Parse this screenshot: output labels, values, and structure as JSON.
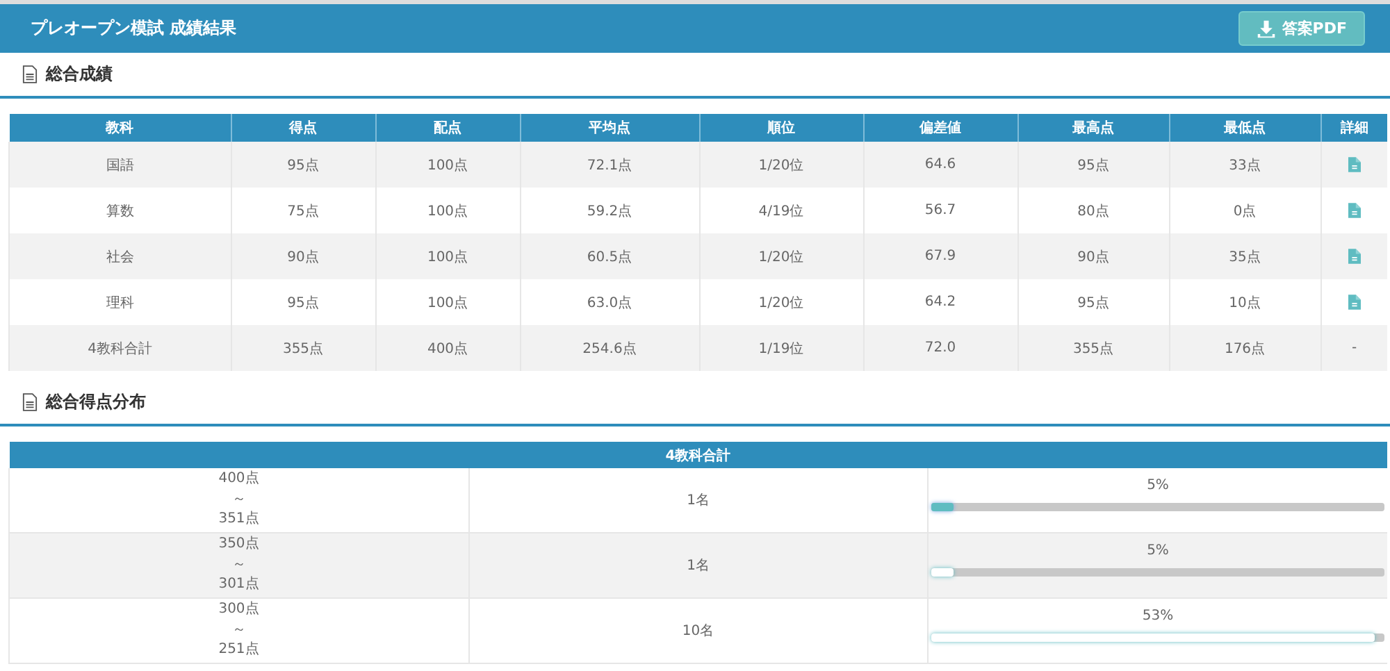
{
  "header": {
    "title": "プレオープン模試 成績結果",
    "pdf_button": "答案PDF"
  },
  "summary": {
    "heading": "総合成績",
    "columns": [
      "教科",
      "得点",
      "配点",
      "平均点",
      "順位",
      "偏差値",
      "最高点",
      "最低点",
      "詳細"
    ],
    "rows": [
      {
        "cells": [
          "国語",
          "95点",
          "100点",
          "72.1点",
          "1/20位",
          "64.6",
          "95点",
          "33点"
        ],
        "detail": {
          "kind": "icon"
        }
      },
      {
        "cells": [
          "算数",
          "75点",
          "100点",
          "59.2点",
          "4/19位",
          "56.7",
          "80点",
          "0点"
        ],
        "detail": {
          "kind": "icon"
        }
      },
      {
        "cells": [
          "社会",
          "90点",
          "100点",
          "60.5点",
          "1/20位",
          "67.9",
          "90点",
          "35点"
        ],
        "detail": {
          "kind": "icon"
        }
      },
      {
        "cells": [
          "理科",
          "95点",
          "100点",
          "63.0点",
          "1/20位",
          "64.2",
          "95点",
          "10点"
        ],
        "detail": {
          "kind": "icon"
        }
      },
      {
        "cells": [
          "4教科合計",
          "355点",
          "400点",
          "254.6点",
          "1/19位",
          "72.0",
          "355点",
          "176点"
        ],
        "detail": {
          "kind": "text",
          "text": "-"
        }
      }
    ]
  },
  "distribution": {
    "heading": "総合得点分布",
    "column": "4教科合計",
    "rows": [
      {
        "from": "400点",
        "sep": "～",
        "to": "351点",
        "count": "1名",
        "percent": "5%",
        "level": 0.05,
        "highlighted": true
      },
      {
        "from": "350点",
        "sep": "～",
        "to": "301点",
        "count": "1名",
        "percent": "5%",
        "level": 0.05,
        "highlighted": false
      },
      {
        "from": "300点",
        "sep": "～",
        "to": "251点",
        "count": "10名",
        "percent": "53%",
        "level": 0.98,
        "highlighted": false
      }
    ]
  }
}
